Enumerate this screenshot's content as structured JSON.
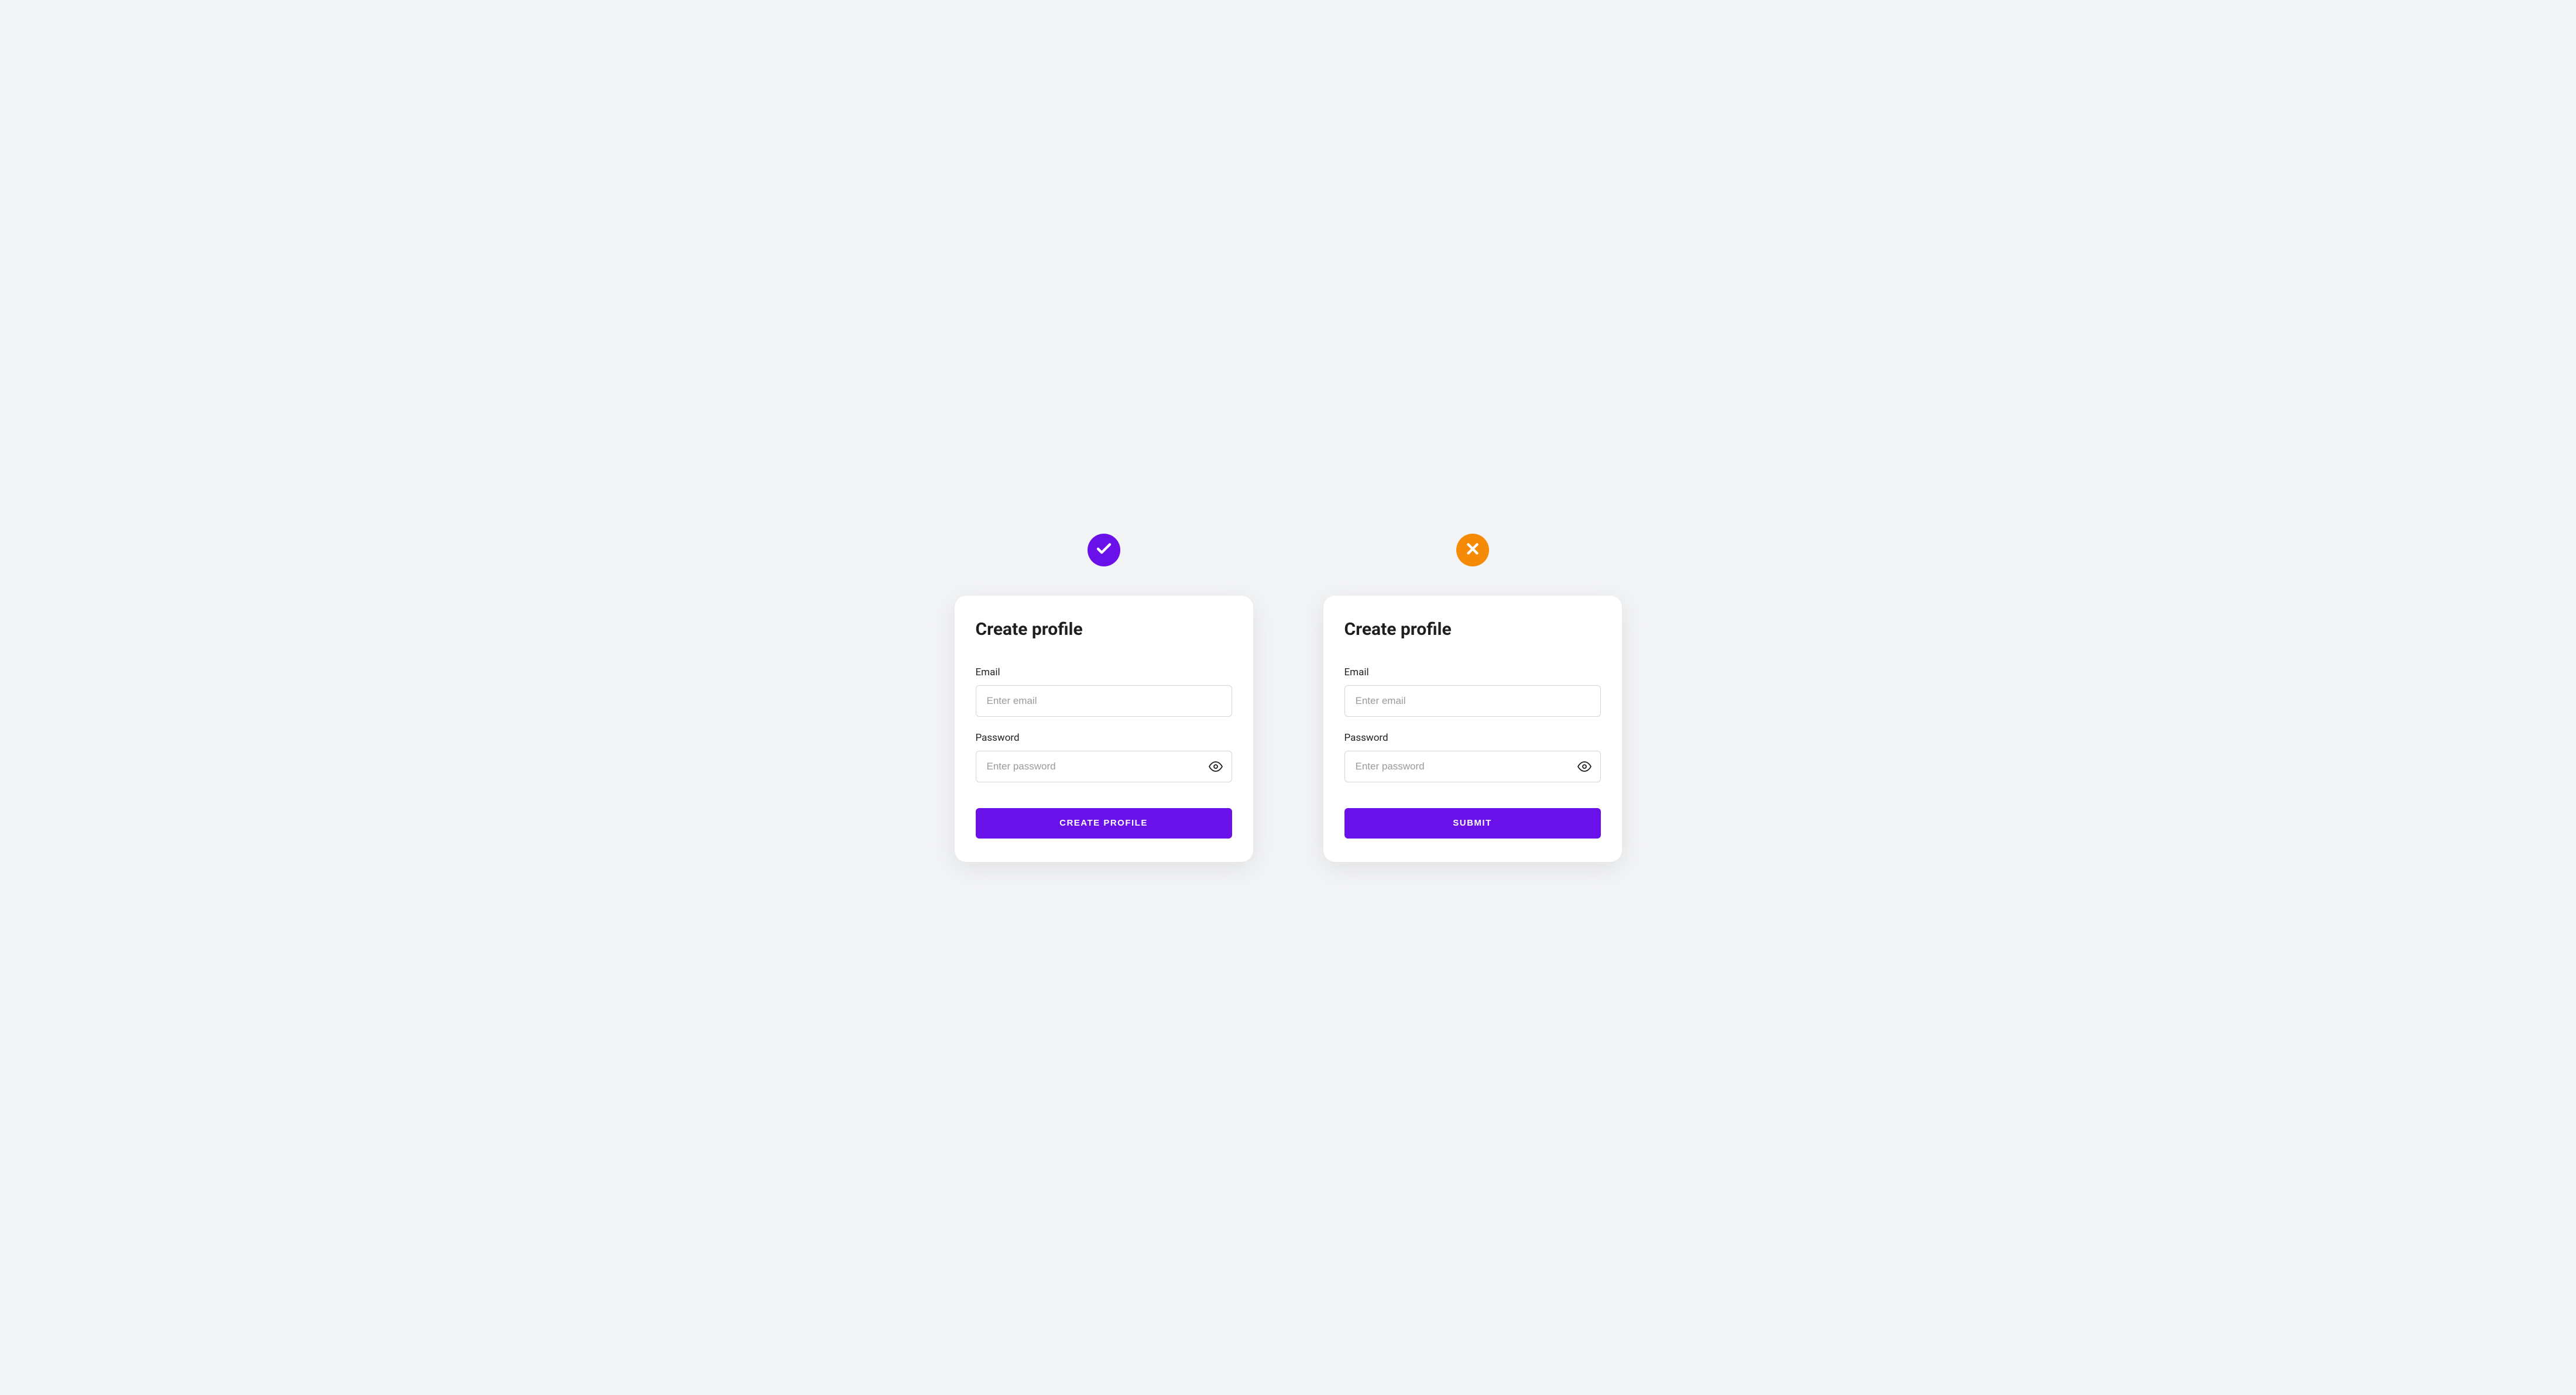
{
  "colors": {
    "accent": "#6a10e8",
    "warn": "#f58a07",
    "bg": "#f2f3f5",
    "cardBg": "#ffffff"
  },
  "good": {
    "badge": "check",
    "title": "Create profile",
    "email": {
      "label": "Email",
      "placeholder": "Enter email"
    },
    "password": {
      "label": "Password",
      "placeholder": "Enter password"
    },
    "submit": "Create Profile"
  },
  "bad": {
    "badge": "cross",
    "title": "Create profile",
    "email": {
      "label": "Email",
      "placeholder": "Enter email"
    },
    "password": {
      "label": "Password",
      "placeholder": "Enter password"
    },
    "submit": "Submit"
  }
}
